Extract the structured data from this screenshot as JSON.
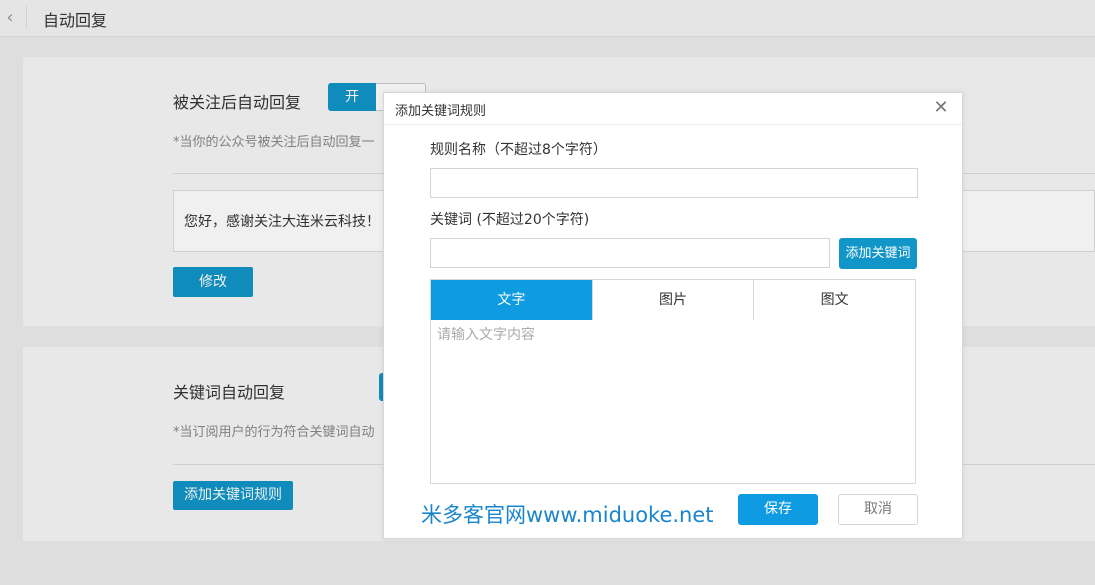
{
  "header": {
    "back_icon": "chevron-left-icon",
    "title": "自动回复"
  },
  "follow_reply": {
    "title": "被关注后自动回复",
    "toggle_on": "开",
    "hint": "*当你的公众号被关注后自动回复一",
    "reply_text": "您好，感谢关注大连米云科技！",
    "edit_button": "修改"
  },
  "keyword_reply": {
    "title": "关键词自动回复",
    "hint": "*当订阅用户的行为符合关键词自动",
    "add_rule_button": "添加关键词规则"
  },
  "modal": {
    "title": "添加关键词规则",
    "close_icon": "close-icon",
    "rule_name_label": "规则名称（不超过8个字符）",
    "rule_name_value": "",
    "keyword_label": "关键词 (不超过20个字符)",
    "keyword_value": "",
    "add_keyword_button": "添加关键词",
    "tabs": [
      {
        "label": "文字",
        "active": true
      },
      {
        "label": "图片",
        "active": false
      },
      {
        "label": "图文",
        "active": false
      }
    ],
    "content_placeholder": "请输入文字内容",
    "watermark": "米多客官网www.miduoke.net",
    "save_button": "保存",
    "cancel_button": "取消"
  },
  "colors": {
    "accent": "#1295c8",
    "tab_active": "#0e9be2",
    "watermark": "#1a85cc"
  }
}
